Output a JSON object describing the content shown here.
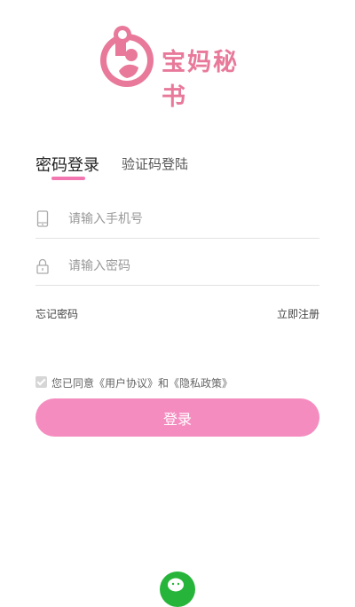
{
  "brand": {
    "name": "宝妈秘书",
    "color": "#e8799a"
  },
  "tabs": {
    "password_login": "密码登录",
    "code_login": "验证码登陆"
  },
  "phone": {
    "placeholder": "请输入手机号"
  },
  "password": {
    "placeholder": "请输入密码"
  },
  "links": {
    "forgot": "忘记密码",
    "register": "立即注册"
  },
  "agreement": {
    "text": "您已同意《用户协议》和《隐私政策》",
    "checked": true
  },
  "login_button": {
    "label": "登录",
    "color": "#f58cc0"
  },
  "social": {
    "wechat_icon": "wechat-icon"
  }
}
